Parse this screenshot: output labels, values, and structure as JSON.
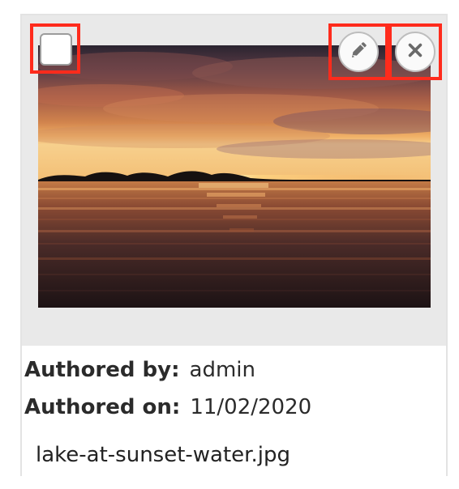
{
  "card": {
    "filename": "lake-at-sunset-water.jpg",
    "author_label": "Authored by:",
    "author_value": "admin",
    "date_label": "Authored on:",
    "date_value": "11/02/2020"
  },
  "actions": {
    "select_icon": "checkbox",
    "edit_icon": "pencil-icon",
    "delete_icon": "close-icon"
  },
  "colors": {
    "highlight": "#ff2b1c",
    "card_border": "#e3e3e3",
    "thumb_background": "#e9e9e9",
    "text": "#2b2b2b"
  }
}
